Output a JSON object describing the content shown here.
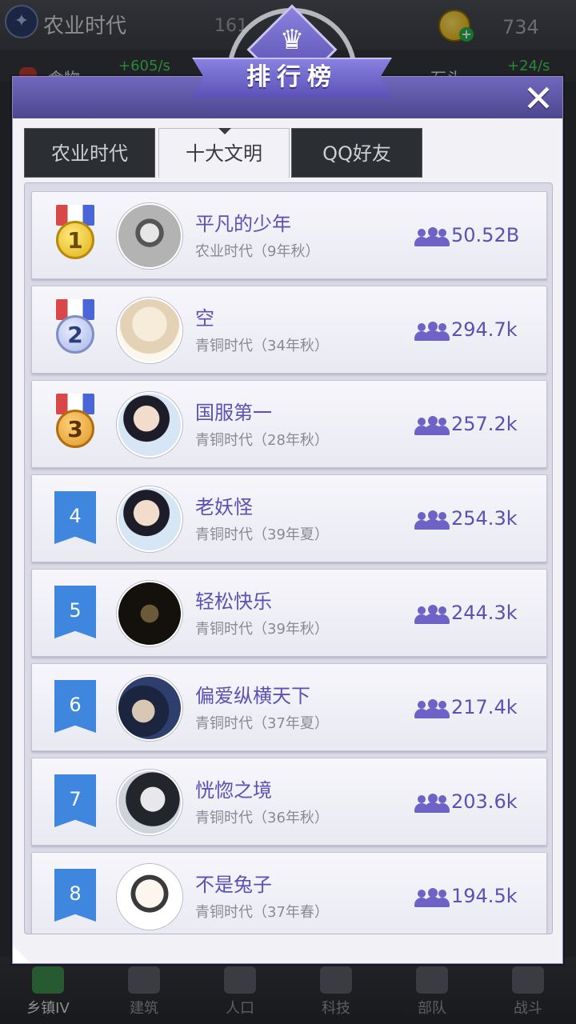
{
  "hud": {
    "era_title": "农业时代",
    "center_number": "161",
    "coin_value": "734",
    "food_label": "食物",
    "food_rate": "+605/s",
    "stone_label": "石头",
    "stone_rate": "+24/s"
  },
  "modal": {
    "title": "排行榜",
    "close_label": "✕",
    "tabs": [
      "农业时代",
      "十大文明",
      "QQ好友"
    ],
    "active_tab": 1
  },
  "rankings": [
    {
      "rank": "1",
      "name": "平凡的少年",
      "era": "农业时代（9年秋）",
      "population": "50.52B",
      "medal": "gold"
    },
    {
      "rank": "2",
      "name": "空",
      "era": "青铜时代（34年秋）",
      "population": "294.7k",
      "medal": "silver"
    },
    {
      "rank": "3",
      "name": "国服第一",
      "era": "青铜时代（28年秋）",
      "population": "257.2k",
      "medal": "bronze"
    },
    {
      "rank": "4",
      "name": "老妖怪",
      "era": "青铜时代（39年夏）",
      "population": "254.3k"
    },
    {
      "rank": "5",
      "name": "轻松快乐",
      "era": "青铜时代（39年秋）",
      "population": "244.3k"
    },
    {
      "rank": "6",
      "name": "偏爱纵横天下",
      "era": "青铜时代（37年夏）",
      "population": "217.4k"
    },
    {
      "rank": "7",
      "name": "恍惚之境",
      "era": "青铜时代（36年秋）",
      "population": "203.6k"
    },
    {
      "rank": "8",
      "name": "不是兔子",
      "era": "青铜时代（37年春）",
      "population": "194.5k"
    }
  ],
  "bottom_nav": [
    {
      "label": "乡镇IV",
      "active": true
    },
    {
      "label": "建筑"
    },
    {
      "label": "人口"
    },
    {
      "label": "科技"
    },
    {
      "label": "部队"
    },
    {
      "label": "战斗"
    }
  ],
  "colors": {
    "accent": "#5b51b5",
    "flag_blue": "#3f86de",
    "modal_bg": "#f1f1f6"
  },
  "icons": {
    "close": "close-icon",
    "title": "crown-icon",
    "population": "population-icon"
  }
}
